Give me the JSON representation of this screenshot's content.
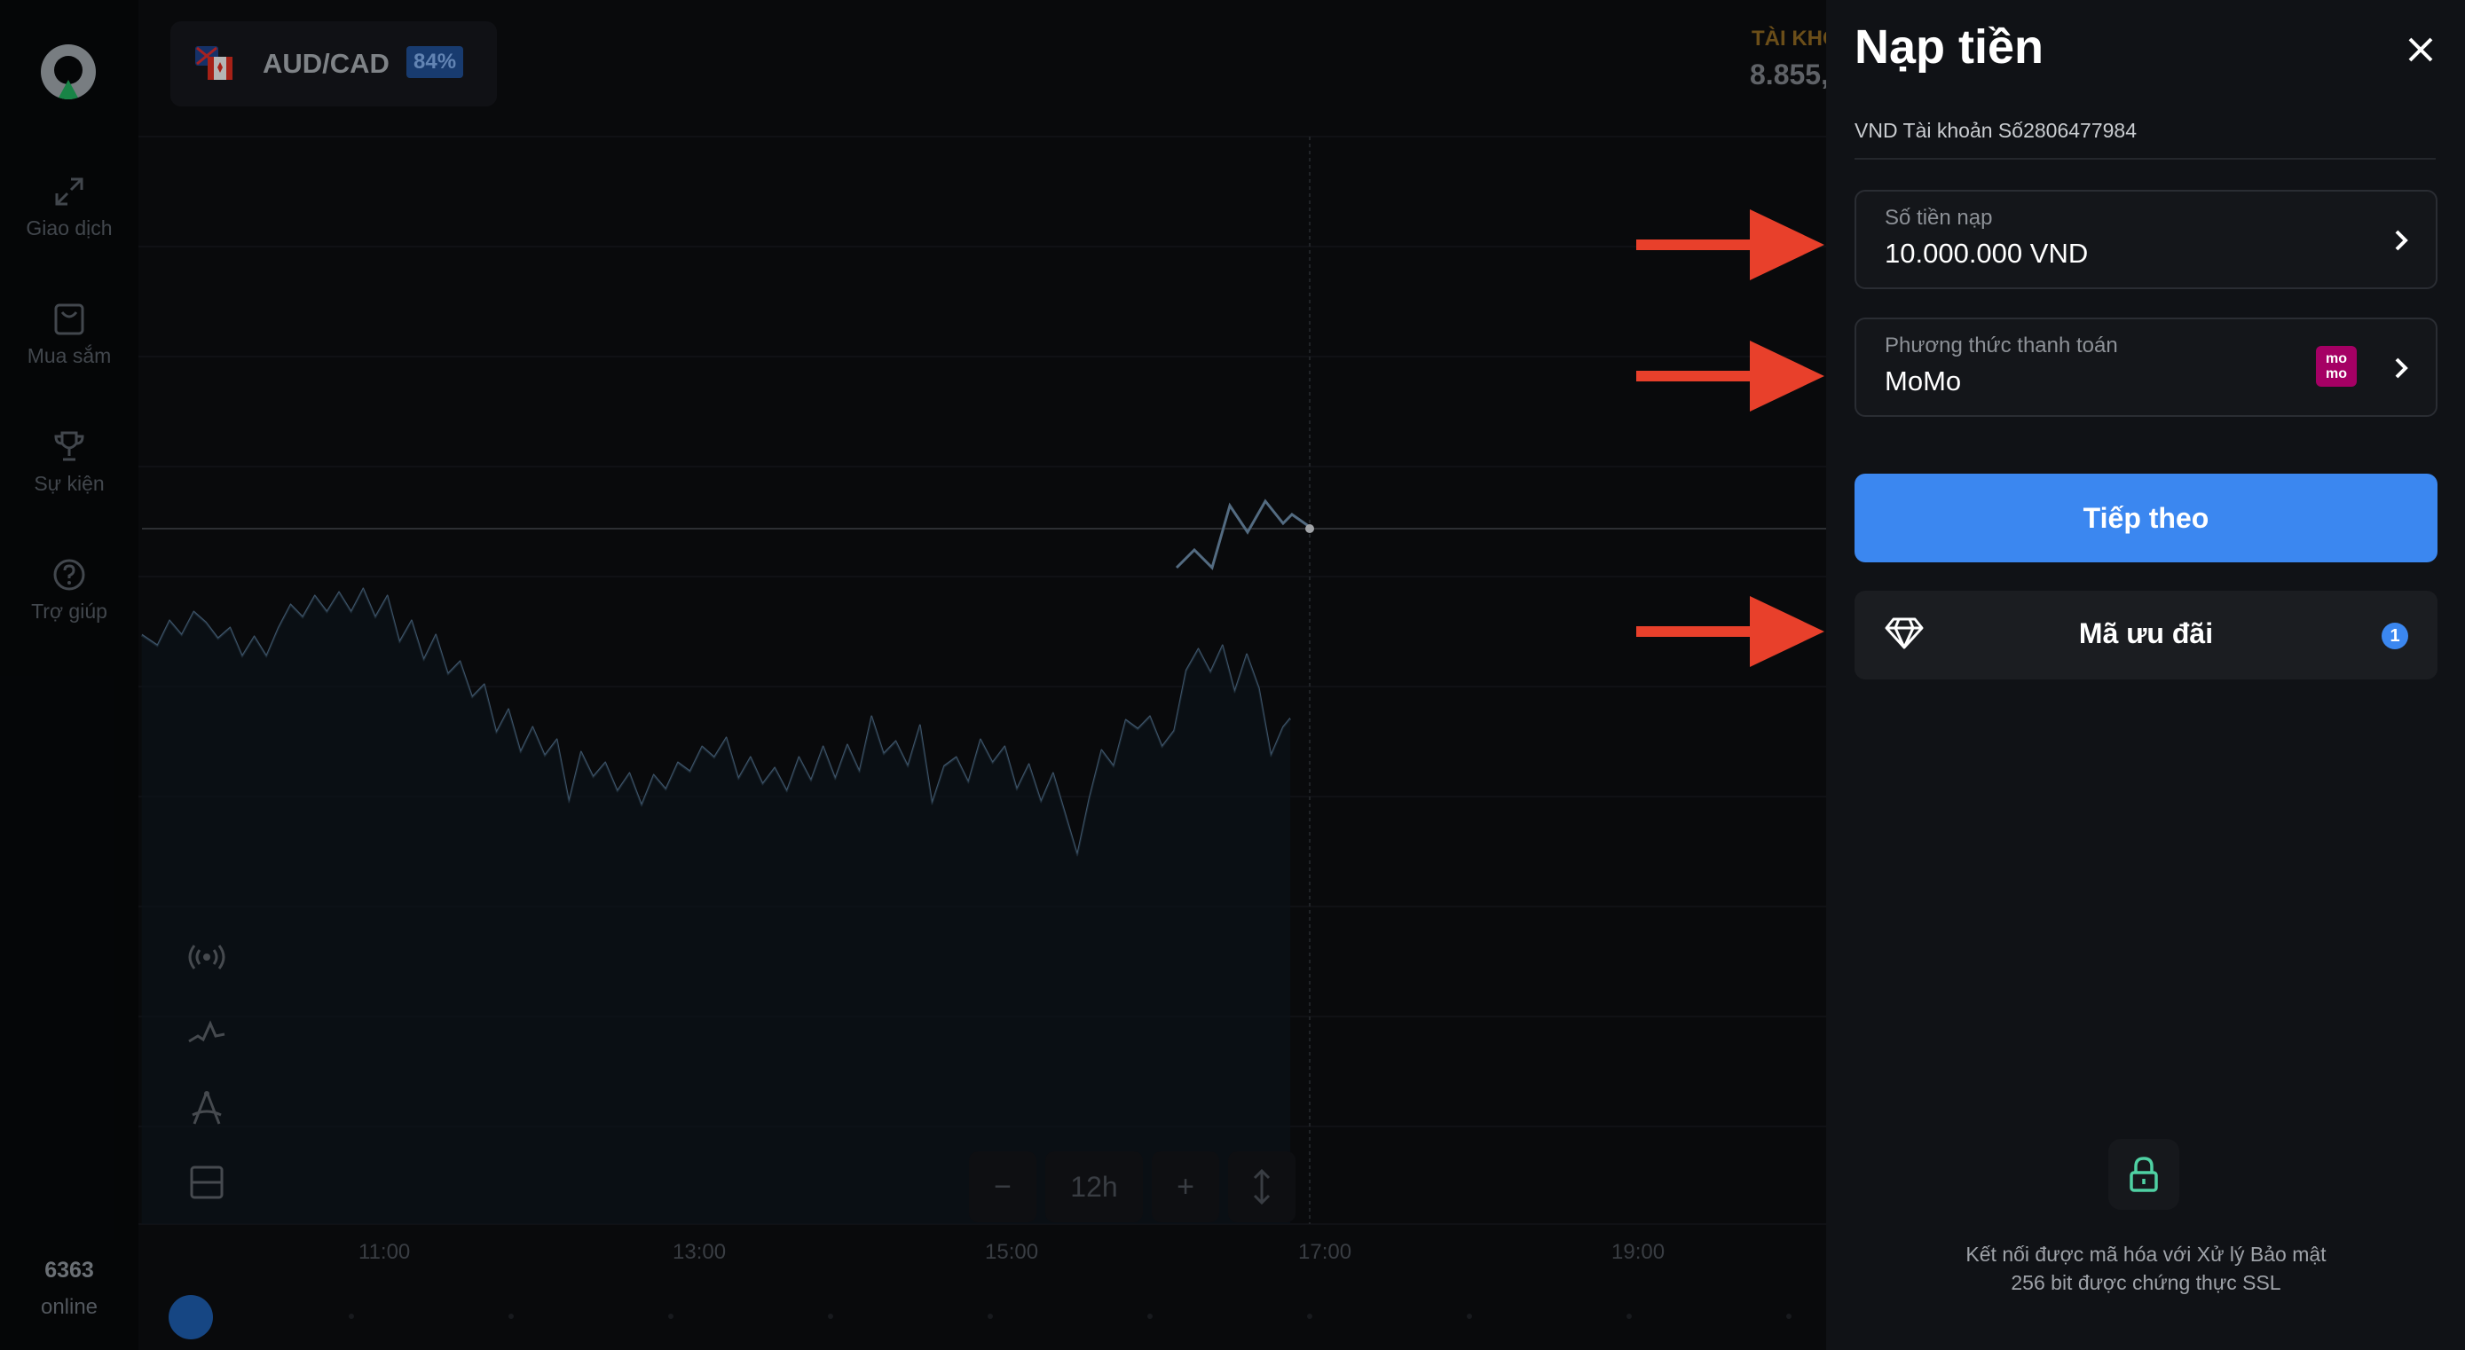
{
  "nav": {
    "items": [
      {
        "label": "Giao dịch",
        "icon": "trade-arrows-icon"
      },
      {
        "label": "Mua sắm",
        "icon": "shopping-bag-icon"
      },
      {
        "label": "Sự kiện",
        "icon": "trophy-icon"
      },
      {
        "label": "Trợ giúp",
        "icon": "help-circle-icon"
      }
    ],
    "online_count": "6363",
    "online_label": "online"
  },
  "asset": {
    "pair": "AUD/CAD",
    "payout": "84%"
  },
  "account_header": {
    "label": "TÀI KHO",
    "value": "8.855,"
  },
  "chart_controls": {
    "zoom_minus": "−",
    "zoom_value": "12h",
    "zoom_plus": "+"
  },
  "time_axis": [
    "11:00",
    "13:00",
    "15:00",
    "17:00",
    "19:00"
  ],
  "deposit": {
    "title": "Nạp tiền",
    "account": "VND Tài khoản Số2806477984",
    "amount_label": "Số tiền nạp",
    "amount_value": "10.000.000 VND",
    "method_label": "Phương thức thanh toán",
    "method_value": "MoMo",
    "method_logo": "mo mo",
    "next_button": "Tiếp theo",
    "promo_label": "Mã ưu đãi",
    "promo_count": "1",
    "security_line1": "Kết nối được mã hóa với Xử lý Bảo mật",
    "security_line2": "256 bit được chứng thực SSL"
  },
  "colors": {
    "accent": "#3b87f0",
    "annotation_arrow": "#e8402b",
    "chart_line": "#4f6b86"
  }
}
